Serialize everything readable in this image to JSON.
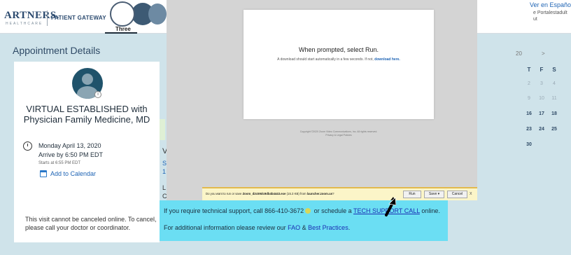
{
  "header": {
    "logo": "ARTNERS.",
    "logo_sub": "HEALTHCARE",
    "gateway": "PATIENT GATEWAY",
    "active_tab": "Three",
    "language_link": "Ver en Español",
    "portal_text_1": "e Portal",
    "portal_text_2": "estadult",
    "portal_text_3": "ut"
  },
  "appointment": {
    "section_title": "Appointment Details",
    "visit_type": "VIRTUAL ESTABLISHED with Physician Family Medicine, MD",
    "date": "Monday April 13, 2020",
    "arrive_by": "Arrive by 6:50 PM EDT",
    "starts_at": "Starts at 6:55 PM EDT",
    "add_to_calendar": "Add to Calendar",
    "cancel_note": "This visit cannot be canceled online. To cancel, please call your doctor or coordinator.",
    "partial_letter": "V",
    "partial_frag_1a": "S",
    "partial_frag_1b": "1",
    "partial_frag_2a": "L",
    "partial_frag_2b": "C"
  },
  "calendar": {
    "month": "20",
    "next": ">",
    "day_headers": [
      "T",
      "F",
      "S"
    ],
    "rows": [
      [
        "2",
        "3",
        "4"
      ],
      [
        "9",
        "10",
        "11"
      ],
      [
        "16",
        "17",
        "18"
      ],
      [
        "23",
        "24",
        "25"
      ],
      [
        "30",
        "",
        ""
      ]
    ],
    "active_days": [
      "16",
      "17",
      "18",
      "23",
      "24",
      "25",
      "30"
    ]
  },
  "download_page": {
    "prompt": "When prompted, select Run.",
    "sub_text": "A download should start automatically in a few seconds. If not,",
    "sub_link": "download here.",
    "copyright_1": "Copyright ©2020 Zoom Video Communications, Inc. All rights reserved.",
    "copyright_2": "Privacy & Legal Policies"
  },
  "download_bar": {
    "question_prefix": "Do you want to run or save",
    "file_name": "Zoom_d2c59dc9db4b4443.exe",
    "file_size": "(15.3 KB)",
    "from_text": "from",
    "source": "launcher.zoom.us",
    "run_label": "Run",
    "save_label": "Save",
    "cancel_label": "Cancel",
    "close_label": "x"
  },
  "support": {
    "line1_prefix": "If you require technical support, call 866-410-3672",
    "line1_mid": "or schedule a",
    "line1_link": "TECH SUPPORT CALL",
    "line1_suffix": "online.",
    "line2_prefix": "For additional information please review our",
    "faq_link": "FAQ",
    "line2_amp": "&",
    "best_practices_link": "Best Practices",
    "line2_end": "."
  },
  "colors": {
    "page_bg": "#cfe3ea",
    "support_bg": "#6bdef3",
    "link": "#2065b5",
    "download_bar_bg": "#fbf5c8"
  }
}
